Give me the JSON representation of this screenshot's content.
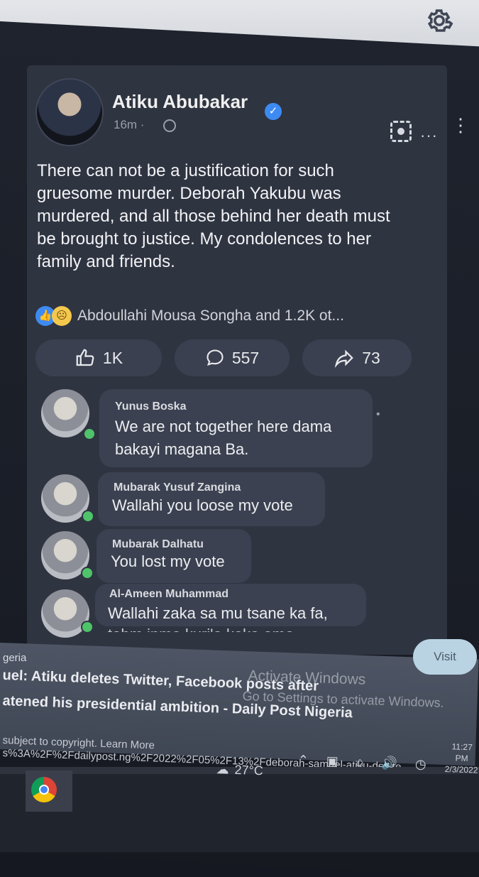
{
  "post": {
    "author": "Atiku Abubakar",
    "time": "16m ·",
    "text": "There can not be a justification for such gruesome murder. Deborah Yakubu was murdered, and all those behind her death must be brought to justice. My condolences to her family and friends.",
    "reactions_summary": "Abdoullahi Mousa Songha and 1.2K ot...",
    "likes": "1K",
    "comments_count": "557",
    "shares": "73"
  },
  "comments": [
    {
      "name": "Yunus Boska",
      "text_line1": "We are not together here dama",
      "text_line2": "bakayi magana Ba."
    },
    {
      "name": "Mubarak Yusuf Zangina",
      "text_line1": "Wallahi you loose my vote"
    },
    {
      "name": "Mubarak Dalhatu",
      "text_line1": "You lost my vote"
    },
    {
      "name": "Al-Ameen Muhammad",
      "text_line1": "Wallahi zaka sa mu tsane ka fa,",
      "text_line2": "tohm inma kuri'a kaka ama"
    }
  ],
  "infobar": {
    "source": "geria",
    "title_line1": "uel: Atiku deletes Twitter, Facebook posts after",
    "title_line2": "atened his presidential ambition - Daily Post Nigeria",
    "copyright": "subject to copyright. Learn More",
    "url": "s%3A%2F%2Fdailypost.ng%2F2022%2F05%2F13%2Fdeborah-samuel-atiku-delete",
    "visit_label": "Visit",
    "watermark_line1": "Activate Windows",
    "watermark_line2": "Go to Settings to activate Windows."
  },
  "taskbar": {
    "temperature": "27°C",
    "time": "11:27 PM",
    "date": "2/3/2022"
  },
  "icons": [
    "gear-icon",
    "verified-icon",
    "globe-icon",
    "screenshot-icon",
    "more-icon",
    "like-icon",
    "comment-icon",
    "share-icon",
    "chrome-icon",
    "weather-icon"
  ]
}
